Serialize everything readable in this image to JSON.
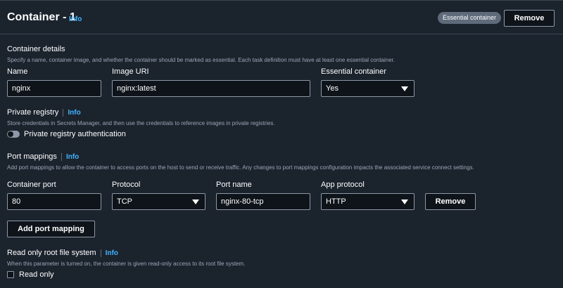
{
  "header": {
    "title": "Container - 1",
    "info": "Info",
    "badge": "Essential container",
    "remove_label": "Remove"
  },
  "container_details": {
    "title": "Container details",
    "description": "Specify a name, container image, and whether the container should be marked as essential. Each task definition must have at least one essential container.",
    "name_label": "Name",
    "name_value": "nginx",
    "image_label": "Image URI",
    "image_value": "nginx:latest",
    "essential_label": "Essential container",
    "essential_value": "Yes"
  },
  "private_registry": {
    "title": "Private registry",
    "info": "Info",
    "description": "Store credentials in Secrets Manager, and then use the credentials to reference images in private registries.",
    "toggle_label": "Private registry authentication"
  },
  "port_mappings": {
    "title": "Port mappings",
    "info": "Info",
    "description": "Add port mappings to allow the container to access ports on the host to send or receive traffic. Any changes to port mappings configuration impacts the associated service connect settings.",
    "container_port_label": "Container port",
    "container_port_value": "80",
    "protocol_label": "Protocol",
    "protocol_value": "TCP",
    "port_name_label": "Port name",
    "port_name_value": "nginx-80-tcp",
    "app_protocol_label": "App protocol",
    "app_protocol_value": "HTTP",
    "remove_label": "Remove",
    "add_label": "Add port mapping"
  },
  "read_only": {
    "title": "Read only root file system",
    "info": "Info",
    "description": "When this parameter is turned on, the container is given read-only access to its root file system.",
    "checkbox_label": "Read only"
  },
  "colors": {
    "panel": "#1b232d",
    "accent": "#42b4ff",
    "border": "#8d99a8"
  }
}
